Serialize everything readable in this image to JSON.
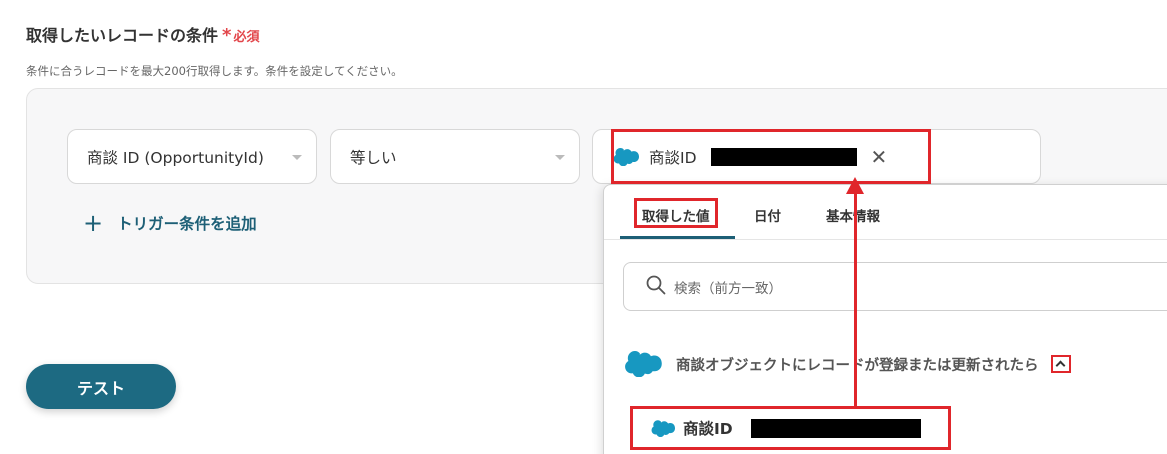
{
  "section": {
    "title": "取得したいレコードの条件",
    "required_star": "*",
    "required_label": "必須",
    "description": "条件に合うレコードを最大200行取得します。条件を設定してください。"
  },
  "condition": {
    "field": "商談 ID (OpportunityId)",
    "operator": "等しい",
    "value_chip_label": "商談ID"
  },
  "add_trigger_label": "トリガー条件を追加",
  "test_button_label": "テスト",
  "dropdown": {
    "tabs": [
      {
        "label": "取得した値",
        "active": true
      },
      {
        "label": "日付",
        "active": false
      },
      {
        "label": "基本情報",
        "active": false
      }
    ],
    "search_placeholder": "検索（前方一致）",
    "group_label": "商談オブジェクトにレコードが登録または更新されたら",
    "item_label": "商談ID"
  },
  "colors": {
    "brand": "#1d6a82",
    "required": "#e2464b",
    "highlight": "#e0262b",
    "salesforce_cloud": "#1798c1"
  },
  "icons": [
    "salesforce-cloud-icon",
    "close-icon",
    "plus-icon",
    "search-icon",
    "chevron-up-icon",
    "caret-down-icon"
  ]
}
